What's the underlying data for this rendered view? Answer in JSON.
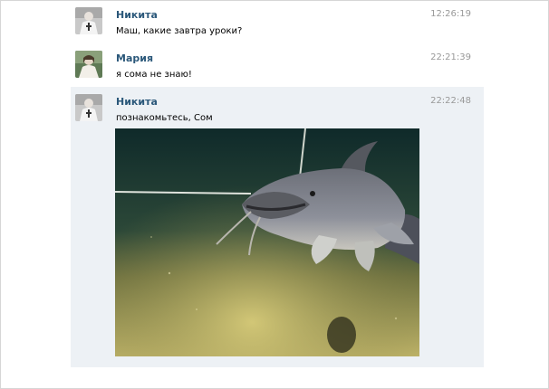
{
  "messages": [
    {
      "author": "Никита",
      "time": "12:26:19",
      "text": "Маш, какие завтра уроки?",
      "avatar_icon": "user-photo-nikita"
    },
    {
      "author": "Мария",
      "time": "22:21:39",
      "text": "я сома не знаю!",
      "avatar_icon": "user-photo-maria"
    },
    {
      "author": "Никита",
      "time": "22:22:48",
      "text": "познакомьтесь, Сом",
      "avatar_icon": "user-photo-nikita",
      "attachment": "catfish-underwater-photo"
    }
  ],
  "colors": {
    "author_link": "#2b587a",
    "timestamp": "#999999",
    "highlight_bg": "#edf1f5"
  }
}
